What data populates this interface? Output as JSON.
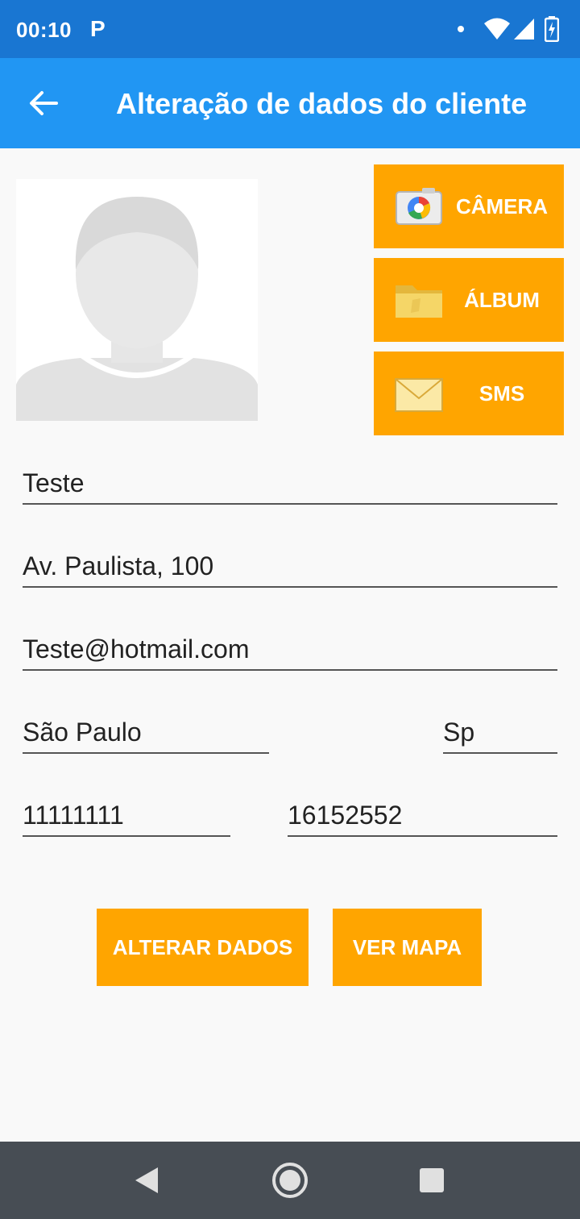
{
  "status_bar": {
    "time": "00:10",
    "notification": "P"
  },
  "app_bar": {
    "title": "Alteração de dados do cliente"
  },
  "photo_buttons": {
    "camera_label": "CÂMERA",
    "album_label": "ÁLBUM",
    "sms_label": "SMS"
  },
  "form": {
    "name": "Teste",
    "address": "Av. Paulista, 100",
    "email": "Teste@hotmail.com",
    "city": "São Paulo",
    "state": "Sp",
    "phone": "11111111",
    "cep": "16152552"
  },
  "actions": {
    "alter_label": "ALTERAR DADOS",
    "map_label": "VER MAPA"
  },
  "colors": {
    "status_bar": "#1976d2",
    "app_bar": "#2196f3",
    "accent_button": "#ffa500",
    "nav_bar": "#474d54"
  },
  "icons": {
    "back": "arrow-left-icon",
    "camera": "camera-icon",
    "album": "folder-icon",
    "sms": "envelope-icon"
  }
}
